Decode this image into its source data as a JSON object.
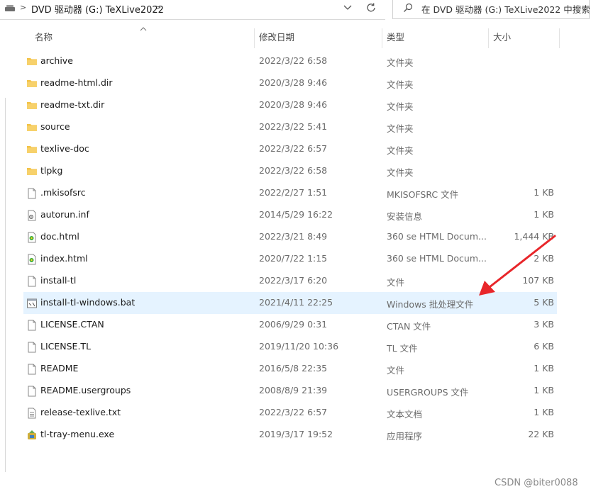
{
  "address": {
    "crumbs": [
      "DVD 驱动器 (G:) TeXLive2022"
    ],
    "search_placeholder": "在 DVD 驱动器 (G:) TeXLive2022 中搜索"
  },
  "columns": {
    "name": "名称",
    "date": "修改日期",
    "type": "类型",
    "size": "大小"
  },
  "files": [
    {
      "name": "archive",
      "date": "2022/3/22 6:58",
      "type": "文件夹",
      "size": "",
      "icon": "folder-icon"
    },
    {
      "name": "readme-html.dir",
      "date": "2020/3/28 9:46",
      "type": "文件夹",
      "size": "",
      "icon": "folder-icon"
    },
    {
      "name": "readme-txt.dir",
      "date": "2020/3/28 9:46",
      "type": "文件夹",
      "size": "",
      "icon": "folder-icon"
    },
    {
      "name": "source",
      "date": "2022/3/22 5:41",
      "type": "文件夹",
      "size": "",
      "icon": "folder-icon"
    },
    {
      "name": "texlive-doc",
      "date": "2022/3/22 6:57",
      "type": "文件夹",
      "size": "",
      "icon": "folder-icon"
    },
    {
      "name": "tlpkg",
      "date": "2022/3/22 6:58",
      "type": "文件夹",
      "size": "",
      "icon": "folder-icon"
    },
    {
      "name": ".mkisofsrc",
      "date": "2022/2/27 1:51",
      "type": "MKISOFSRC 文件",
      "size": "1 KB",
      "icon": "file-icon"
    },
    {
      "name": "autorun.inf",
      "date": "2014/5/29 16:22",
      "type": "安装信息",
      "size": "1 KB",
      "icon": "settings-file-icon"
    },
    {
      "name": "doc.html",
      "date": "2022/3/21 8:49",
      "type": "360 se HTML Docum...",
      "size": "1,444 KB",
      "icon": "html-file-icon"
    },
    {
      "name": "index.html",
      "date": "2020/7/22 1:15",
      "type": "360 se HTML Docum...",
      "size": "2 KB",
      "icon": "html-file-icon"
    },
    {
      "name": "install-tl",
      "date": "2022/3/17 6:20",
      "type": "文件",
      "size": "107 KB",
      "icon": "file-icon"
    },
    {
      "name": "install-tl-windows.bat",
      "date": "2021/4/11 22:25",
      "type": "Windows 批处理文件",
      "size": "5 KB",
      "icon": "batch-file-icon",
      "selected": true
    },
    {
      "name": "LICENSE.CTAN",
      "date": "2006/9/29 0:31",
      "type": "CTAN 文件",
      "size": "3 KB",
      "icon": "file-icon"
    },
    {
      "name": "LICENSE.TL",
      "date": "2019/11/20 10:36",
      "type": "TL 文件",
      "size": "6 KB",
      "icon": "file-icon"
    },
    {
      "name": "README",
      "date": "2016/5/8 22:35",
      "type": "文件",
      "size": "1 KB",
      "icon": "file-icon"
    },
    {
      "name": "README.usergroups",
      "date": "2008/8/9 21:39",
      "type": "USERGROUPS 文件",
      "size": "1 KB",
      "icon": "file-icon"
    },
    {
      "name": "release-texlive.txt",
      "date": "2022/3/22 6:57",
      "type": "文本文档",
      "size": "1 KB",
      "icon": "text-file-icon"
    },
    {
      "name": "tl-tray-menu.exe",
      "date": "2019/3/17 19:52",
      "type": "应用程序",
      "size": "22 KB",
      "icon": "exe-icon"
    }
  ],
  "colors": {
    "selection": "#e5f3ff",
    "folder": "#f3c348",
    "arrow": "#e8262a"
  },
  "watermark": "CSDN @biter0088"
}
